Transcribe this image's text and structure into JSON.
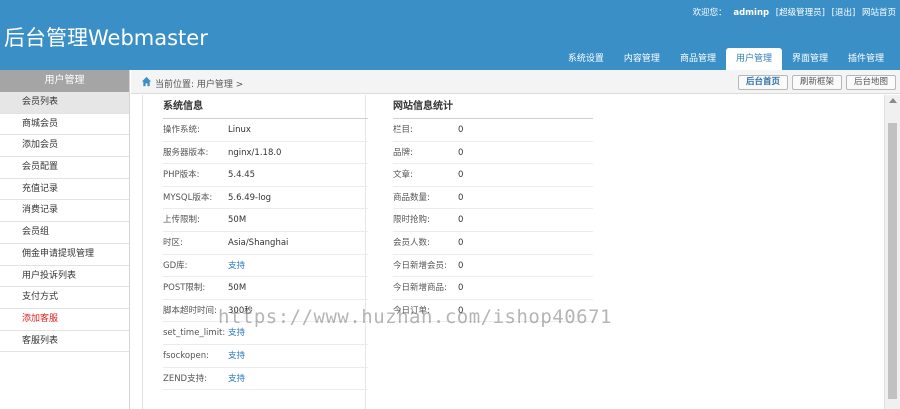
{
  "header": {
    "logo": "后台管理Webmaster",
    "welcome_prefix": "欢迎您：",
    "username": "adminp",
    "role": "[超级管理员]",
    "logout": "[退出]",
    "site_home": "网站首页",
    "nav": [
      {
        "label": "系统设置",
        "active": false
      },
      {
        "label": "内容管理",
        "active": false
      },
      {
        "label": "商品管理",
        "active": false
      },
      {
        "label": "用户管理",
        "active": true
      },
      {
        "label": "界面管理",
        "active": false
      },
      {
        "label": "插件管理",
        "active": false
      }
    ]
  },
  "sidebar": {
    "heading": "用户管理",
    "items": [
      {
        "label": "会员列表",
        "active": true,
        "red": false
      },
      {
        "label": "商城会员",
        "active": false,
        "red": false
      },
      {
        "label": "添加会员",
        "active": false,
        "red": false
      },
      {
        "label": "会员配置",
        "active": false,
        "red": false
      },
      {
        "label": "充值记录",
        "active": false,
        "red": false
      },
      {
        "label": "消费记录",
        "active": false,
        "red": false
      },
      {
        "label": "会员组",
        "active": false,
        "red": false
      },
      {
        "label": "佣金申请提现管理",
        "active": false,
        "red": false
      },
      {
        "label": "用户投诉列表",
        "active": false,
        "red": false
      },
      {
        "label": "支付方式",
        "active": false,
        "red": false
      },
      {
        "label": "添加客服",
        "active": false,
        "red": true
      },
      {
        "label": "客服列表",
        "active": false,
        "red": false
      }
    ]
  },
  "breadcrumb": {
    "text": "当前位置: 用户管理 >",
    "buttons": [
      "后台首页",
      "刷新框架",
      "后台地图"
    ]
  },
  "system_info": {
    "title": "系统信息",
    "rows": [
      {
        "label": "操作系统:",
        "value": "Linux",
        "link": false
      },
      {
        "label": "服务器版本:",
        "value": "nginx/1.18.0",
        "link": false
      },
      {
        "label": "PHP版本:",
        "value": "5.4.45",
        "link": false
      },
      {
        "label": "MYSQL版本:",
        "value": "5.6.49-log",
        "link": false
      },
      {
        "label": "上传限制:",
        "value": "50M",
        "link": false
      },
      {
        "label": "时区:",
        "value": "Asia/Shanghai",
        "link": false
      },
      {
        "label": "GD库:",
        "value": "支持",
        "link": true
      },
      {
        "label": "POST限制:",
        "value": "50M",
        "link": false
      },
      {
        "label": "脚本超时时间:",
        "value": "300秒",
        "link": false
      },
      {
        "label": "set_time_limit:",
        "value": "支持",
        "link": true
      },
      {
        "label": "fsockopen:",
        "value": "支持",
        "link": true
      },
      {
        "label": "ZEND支持:",
        "value": "支持",
        "link": true
      }
    ]
  },
  "site_stats": {
    "title": "网站信息统计",
    "rows": [
      {
        "label": "栏目:",
        "value": "0"
      },
      {
        "label": "品牌:",
        "value": "0"
      },
      {
        "label": "文章:",
        "value": "0"
      },
      {
        "label": "商品数量:",
        "value": "0"
      },
      {
        "label": "限时抢购:",
        "value": "0"
      },
      {
        "label": "会员人数:",
        "value": "0"
      },
      {
        "label": "今日新增会员:",
        "value": "0"
      },
      {
        "label": "今日新增商品:",
        "value": "0"
      },
      {
        "label": "今日订单:",
        "value": "0"
      }
    ]
  },
  "watermark": "https://www.huzhan.com/ishop40671",
  "colors": {
    "header_bg": "#3a8fc7",
    "link": "#2a78c0",
    "red_item": "#e02020"
  }
}
